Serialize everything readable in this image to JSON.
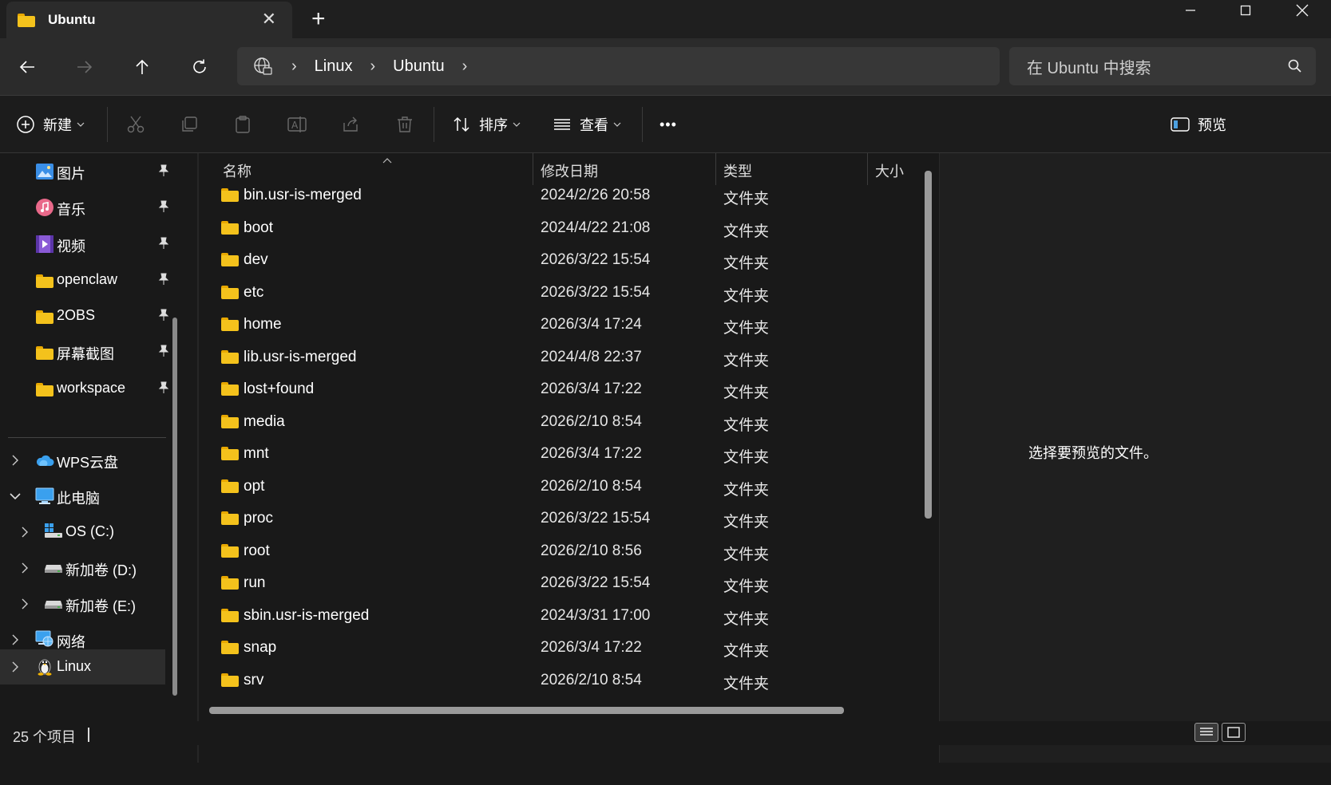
{
  "window": {
    "tab_title": "Ubuntu",
    "colors": {
      "folder": "#f4c21c",
      "accent": "#4ca0e0"
    }
  },
  "address": {
    "crumbs": [
      "Linux",
      "Ubuntu"
    ],
    "search_placeholder": "在 Ubuntu 中搜索"
  },
  "toolbar": {
    "new_label": "新建",
    "sort_label": "排序",
    "view_label": "查看",
    "more_label": "•••",
    "preview_label": "预览"
  },
  "sidebar": {
    "pinned": [
      {
        "label": "图片",
        "icon": "pictures-icon"
      },
      {
        "label": "音乐",
        "icon": "music-icon"
      },
      {
        "label": "视频",
        "icon": "videos-icon"
      },
      {
        "label": "openclaw",
        "icon": "folder-icon"
      },
      {
        "label": "2OBS",
        "icon": "folder-icon"
      },
      {
        "label": "屏幕截图",
        "icon": "folder-icon"
      },
      {
        "label": "workspace",
        "icon": "folder-icon"
      }
    ],
    "tree": [
      {
        "label": "WPS云盘",
        "icon": "cloud-icon"
      },
      {
        "label": "此电脑",
        "icon": "computer-icon"
      },
      {
        "label": "OS (C:)",
        "icon": "os-drive-icon"
      },
      {
        "label": "新加卷 (D:)",
        "icon": "drive-icon"
      },
      {
        "label": "新加卷 (E:)",
        "icon": "drive-icon"
      },
      {
        "label": "网络",
        "icon": "network-icon"
      },
      {
        "label": "Linux",
        "icon": "linux-icon"
      }
    ]
  },
  "columns": {
    "name": "名称",
    "date": "修改日期",
    "type": "类型",
    "size": "大小"
  },
  "files": [
    {
      "name": "bin.usr-is-merged",
      "date": "2024/2/26 20:58",
      "type": "文件夹"
    },
    {
      "name": "boot",
      "date": "2024/4/22 21:08",
      "type": "文件夹"
    },
    {
      "name": "dev",
      "date": "2026/3/22 15:54",
      "type": "文件夹"
    },
    {
      "name": "etc",
      "date": "2026/3/22 15:54",
      "type": "文件夹"
    },
    {
      "name": "home",
      "date": "2026/3/4 17:24",
      "type": "文件夹"
    },
    {
      "name": "lib.usr-is-merged",
      "date": "2024/4/8 22:37",
      "type": "文件夹"
    },
    {
      "name": "lost+found",
      "date": "2026/3/4 17:22",
      "type": "文件夹"
    },
    {
      "name": "media",
      "date": "2026/2/10 8:54",
      "type": "文件夹"
    },
    {
      "name": "mnt",
      "date": "2026/3/4 17:22",
      "type": "文件夹"
    },
    {
      "name": "opt",
      "date": "2026/2/10 8:54",
      "type": "文件夹"
    },
    {
      "name": "proc",
      "date": "2026/3/22 15:54",
      "type": "文件夹"
    },
    {
      "name": "root",
      "date": "2026/2/10 8:56",
      "type": "文件夹"
    },
    {
      "name": "run",
      "date": "2026/3/22 15:54",
      "type": "文件夹"
    },
    {
      "name": "sbin.usr-is-merged",
      "date": "2024/3/31 17:00",
      "type": "文件夹"
    },
    {
      "name": "snap",
      "date": "2026/3/4 17:22",
      "type": "文件夹"
    },
    {
      "name": "srv",
      "date": "2026/2/10 8:54",
      "type": "文件夹"
    }
  ],
  "preview": {
    "message": "选择要预览的文件。"
  },
  "status": {
    "item_count": "25 个项目"
  }
}
